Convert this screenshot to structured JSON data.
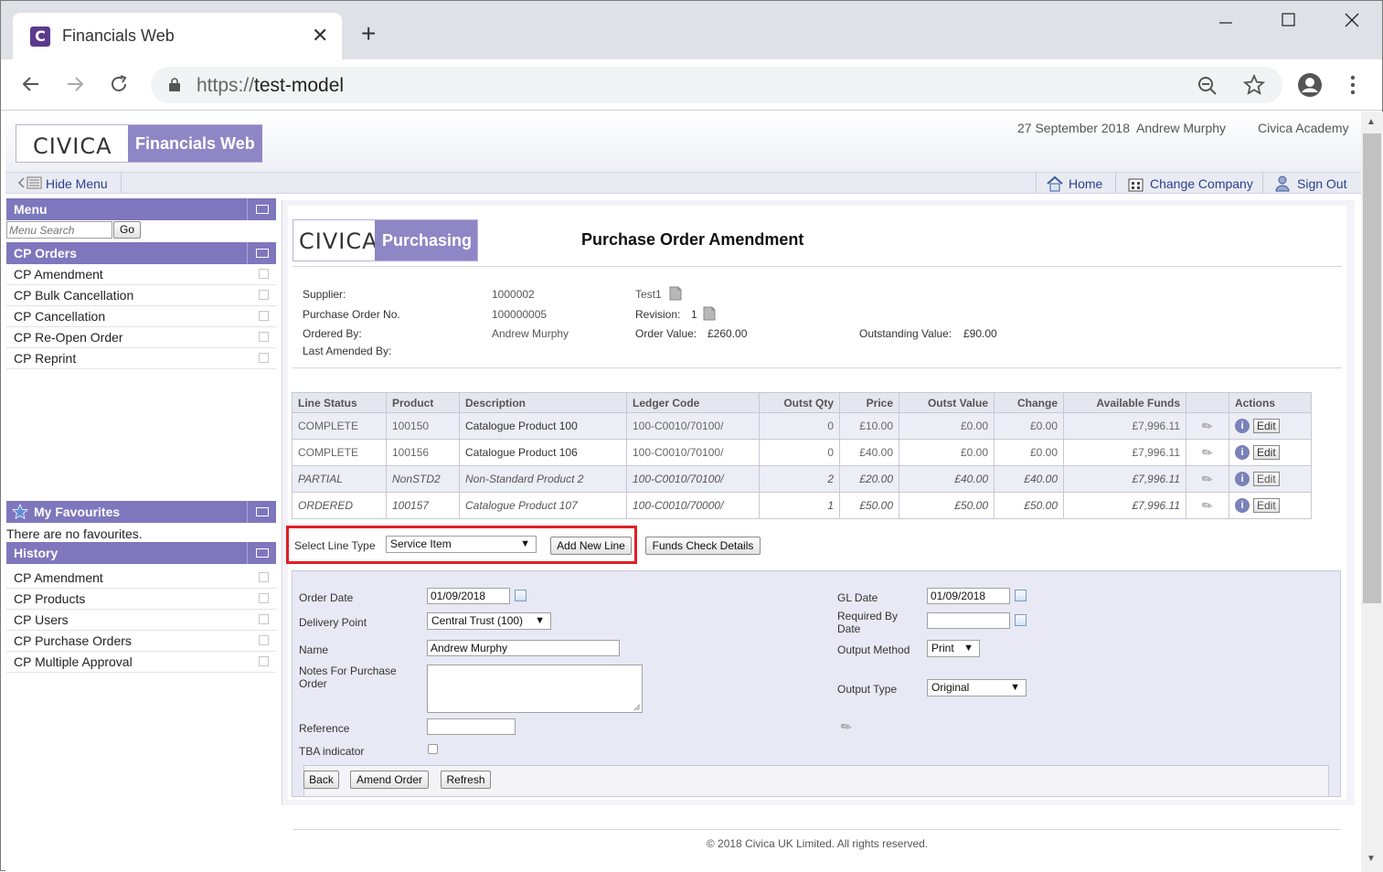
{
  "browser": {
    "tab_title": "Financials Web",
    "favicon_letter": "C",
    "tab_close": "✕",
    "new_tab": "+",
    "url_scheme": "https://",
    "url_host": "test-model"
  },
  "app": {
    "logo_text": "CIVICA",
    "product_name": "Financials Web",
    "date": "27 September 2018",
    "user": "Andrew Murphy",
    "company": "Civica Academy"
  },
  "navbar": {
    "hide_menu": "Hide Menu",
    "home": "Home",
    "change_company": "Change Company",
    "sign_out": "Sign Out"
  },
  "sidebar": {
    "menu_title": "Menu",
    "search_placeholder": "Menu Search",
    "go_label": "Go",
    "cp_orders_title": "CP Orders",
    "cp_orders": [
      "CP Amendment",
      "CP Bulk Cancellation",
      "CP Cancellation",
      "CP Re-Open Order",
      "CP Reprint"
    ],
    "favourites_title": "My Favourites",
    "favourites_empty": "There are no favourites.",
    "history_title": "History",
    "history": [
      "CP Amendment",
      "CP Products",
      "CP Users",
      "CP Purchase Orders",
      "CP Multiple Approval"
    ]
  },
  "page": {
    "module_logo": "CIVICA",
    "module_name": "Purchasing",
    "title": "Purchase Order Amendment"
  },
  "summary": {
    "supplier_label": "Supplier:",
    "supplier_code": "1000002",
    "supplier_name": "Test1",
    "po_label": "Purchase Order No.",
    "po_number": "100000005",
    "revision_label": "Revision:",
    "revision": "1",
    "ordered_by_label": "Ordered By:",
    "ordered_by": "Andrew Murphy",
    "order_value_label": "Order Value:",
    "order_value": "£260.00",
    "outstanding_label": "Outstanding Value:",
    "outstanding_value": "£90.00",
    "last_amended_label": "Last Amended By:"
  },
  "lines": {
    "headers": [
      "Line Status",
      "Product",
      "Description",
      "Ledger Code",
      "Outst Qty",
      "Price",
      "Outst Value",
      "Change",
      "Available Funds",
      "",
      "Actions"
    ],
    "edit_label": "Edit",
    "info_glyph": "i",
    "clip_glyph": "✎",
    "rows": [
      {
        "status": "COMPLETE",
        "product": "100150",
        "description": "Catalogue Product 100",
        "ledger": "100-C0010/70100/",
        "qty": "0",
        "price": "£10.00",
        "outst": "£0.00",
        "change": "£0.00",
        "funds": "£7,996.11"
      },
      {
        "status": "COMPLETE",
        "product": "100156",
        "description": "Catalogue Product 106",
        "ledger": "100-C0010/70100/",
        "qty": "0",
        "price": "£40.00",
        "outst": "£0.00",
        "change": "£0.00",
        "funds": "£7,996.11"
      },
      {
        "status": "PARTIAL",
        "product": "NonSTD2",
        "description": "Non-Standard Product 2",
        "ledger": "100-C0010/70100/",
        "qty": "2",
        "price": "£20.00",
        "outst": "£40.00",
        "change": "£40.00",
        "funds": "£7,996.11"
      },
      {
        "status": "ORDERED",
        "product": "100157",
        "description": "Catalogue Product 107",
        "ledger": "100-C0010/70000/",
        "qty": "1",
        "price": "£50.00",
        "outst": "£50.00",
        "change": "£50.00",
        "funds": "£7,996.11"
      }
    ]
  },
  "linetype": {
    "label": "Select Line Type",
    "selected": "Service Item",
    "add_button": "Add New Line",
    "funds_button": "Funds Check Details"
  },
  "form": {
    "order_date_label": "Order Date",
    "order_date": "01/09/2018",
    "delivery_label": "Delivery Point",
    "delivery": "Central Trust (100)",
    "name_label": "Name",
    "name": "Andrew Murphy",
    "notes_label": "Notes For Purchase Order",
    "reference_label": "Reference",
    "tba_label": "TBA indicator",
    "gl_date_label": "GL Date",
    "gl_date": "01/09/2018",
    "required_by_label": "Required By Date",
    "output_method_label": "Output Method",
    "output_method": "Print",
    "output_type_label": "Output Type",
    "output_type": "Original",
    "back": "Back",
    "amend": "Amend Order",
    "refresh": "Refresh"
  },
  "footer": "© 2018 Civica UK Limited. All rights reserved."
}
